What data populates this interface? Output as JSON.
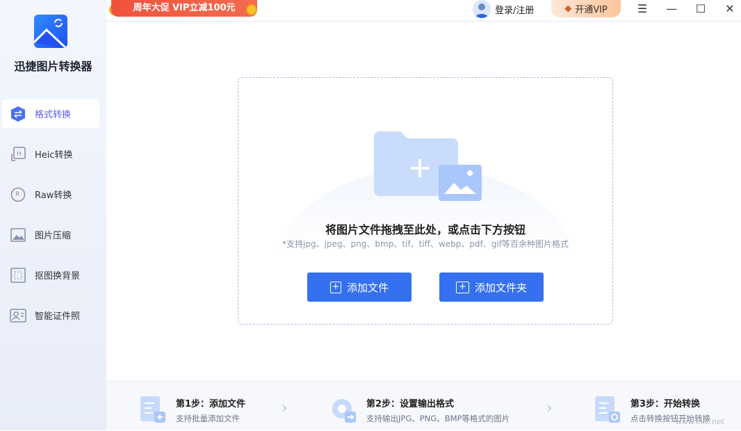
{
  "app": {
    "title": "迅捷图片转换器"
  },
  "promo": "周年大促 VIP立减100元",
  "header": {
    "login_label": "登录/注册",
    "vip": "开通VIP"
  },
  "sidebar": {
    "items": [
      {
        "label": "格式转换"
      },
      {
        "label": "Heic转换"
      },
      {
        "label": "Raw转换"
      },
      {
        "label": "图片压缩"
      },
      {
        "label": "抠图换背景"
      },
      {
        "label": "智能证件照"
      }
    ]
  },
  "drop": {
    "title": "将图片文件拖拽至此处，或点击下方按钮",
    "subtitle": "*支持jpg、jpeg、png、bmp、tif、tiff、webp、pdf、gif等百余种图片格式",
    "add_file": "添加文件",
    "add_folder": "添加文件夹"
  },
  "steps": [
    {
      "title": "第1步：添加文件",
      "desc": "支持批量添加文件"
    },
    {
      "title": "第2步：设置输出格式",
      "desc": "支持输出JPG、PNG、BMP等格式的图片"
    },
    {
      "title": "第3步：开始转换",
      "desc": "点击转换按钮开始转换"
    }
  ],
  "watermark": "www.kkx.net",
  "colors": {
    "accent": "#3470f0",
    "active": "#5a5cf0"
  }
}
